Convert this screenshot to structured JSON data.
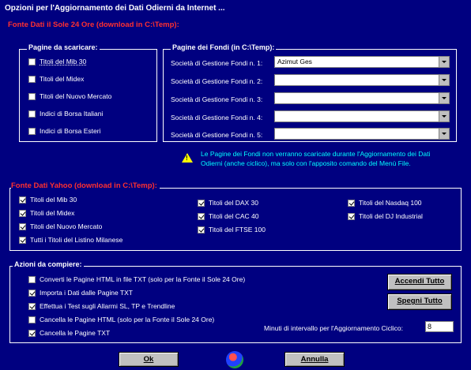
{
  "title": "Opzioni per l'Aggiornamento dei Dati Odierni da Internet ...",
  "sole": {
    "section_title": "Fonte Dati il Sole 24 Ore (download in C:\\Temp):",
    "pagine_title": "Pagine da scaricare:",
    "pagine": [
      {
        "label": "Titoli del Mib 30",
        "checked": false
      },
      {
        "label": "Titoli del Midex",
        "checked": false
      },
      {
        "label": "Titoli del Nuovo Mercato",
        "checked": false
      },
      {
        "label": "Indici di Borsa Italiani",
        "checked": false
      },
      {
        "label": "Indici di Borsa Esteri",
        "checked": false
      }
    ],
    "fondi_title": "Pagine dei Fondi (in C:\\Temp):",
    "fondi": [
      {
        "label": "Società di Gestione Fondi n. 1:",
        "value": "Azimut Ges"
      },
      {
        "label": "Società di Gestione Fondi n. 2:",
        "value": ""
      },
      {
        "label": "Società di Gestione Fondi n. 3:",
        "value": ""
      },
      {
        "label": "Società di Gestione Fondi n. 4:",
        "value": ""
      },
      {
        "label": "Società di Gestione Fondi n. 5:",
        "value": ""
      }
    ],
    "warning_line1": "Le Pagine dei Fondi non verranno scaricate durante l'Aggiornamento dei Dati",
    "warning_line2": "Odierni (anche ciclico), ma solo con l'apposito comando del Menù File."
  },
  "yahoo": {
    "section_title": "Fonte Dati Yahoo (download in C:\\Temp):",
    "items": [
      {
        "label": "Titoli del Mib 30",
        "checked": true
      },
      {
        "label": "Titoli del Midex",
        "checked": true
      },
      {
        "label": "Titoli del Nuovo Mercato",
        "checked": true
      },
      {
        "label": "Tutti i Titoli del Listino Milanese",
        "checked": true
      },
      {
        "label": "Titoli del DAX 30",
        "checked": true
      },
      {
        "label": "Titoli del CAC 40",
        "checked": true
      },
      {
        "label": "Titoli del FTSE 100",
        "checked": true
      },
      {
        "label": "Titoli del Nasdaq 100",
        "checked": true
      },
      {
        "label": "Titoli del DJ Industrial",
        "checked": true
      }
    ]
  },
  "azioni": {
    "section_title": "Azioni da compiere:",
    "items": [
      {
        "label": "Converti le Pagine HTML in file TXT (solo per la Fonte il Sole 24 Ore)",
        "checked": false
      },
      {
        "label": "Importa i Dati dalle Pagine TXT",
        "checked": true
      },
      {
        "label": "Effettua i Test sugli Allarmi SL, TP e Trendline",
        "checked": true
      },
      {
        "label": "Cancella le Pagine HTML (solo per la Fonte il Sole 24 Ore)",
        "checked": false
      },
      {
        "label": "Cancella le Pagine TXT",
        "checked": true
      }
    ],
    "accendi": "Accendi Tutto",
    "spegni": "Spegni Tutto",
    "minuti_label": "Minuti di intervallo per l'Aggiornamento Ciclico:",
    "minuti_value": "8"
  },
  "ok": "Ok",
  "annulla": "Annulla"
}
